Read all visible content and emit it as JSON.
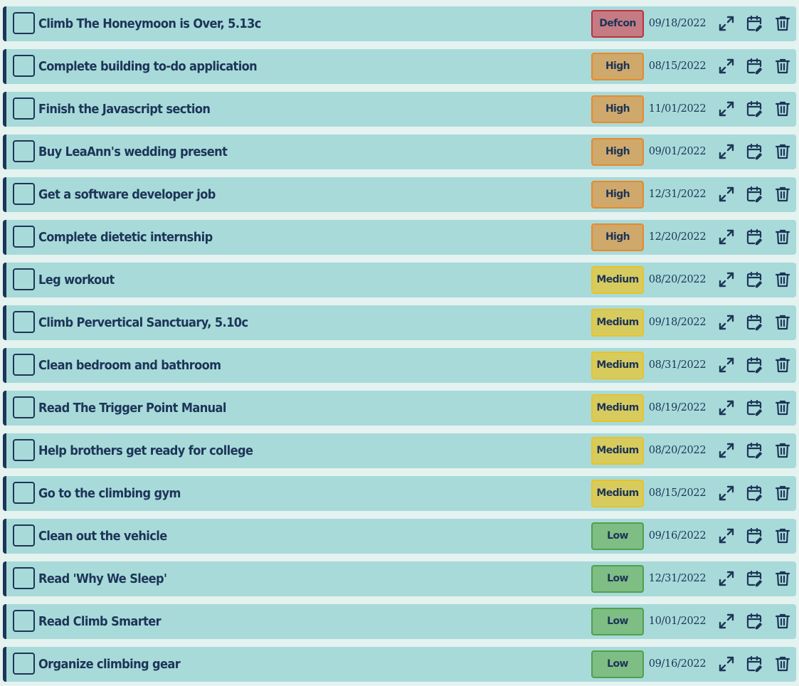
{
  "colors": {
    "background": "#e4f2f0",
    "row": "#a8dada",
    "text": "#1d3557",
    "priority": {
      "Defcon": {
        "bg": "#c47b84",
        "border": "#c0303d"
      },
      "High": {
        "bg": "#cfa86b",
        "border": "#e8892b"
      },
      "Medium": {
        "bg": "#d8cb5e",
        "border": "#e7c325"
      },
      "Low": {
        "bg": "#7ebd84",
        "border": "#4fa04b"
      }
    }
  },
  "icons": {
    "expand": "expand-diagonal-icon",
    "reschedule": "calendar-edit-icon",
    "delete": "trash-icon"
  },
  "todos": [
    {
      "title": "Climb The Honeymoon is Over, 5.13c",
      "priority": "Defcon",
      "date": "09/18/2022"
    },
    {
      "title": "Complete building to-do application",
      "priority": "High",
      "date": "08/15/2022"
    },
    {
      "title": "Finish the Javascript section",
      "priority": "High",
      "date": "11/01/2022"
    },
    {
      "title": "Buy LeaAnn's wedding present",
      "priority": "High",
      "date": "09/01/2022"
    },
    {
      "title": "Get a software developer job",
      "priority": "High",
      "date": "12/31/2022"
    },
    {
      "title": "Complete dietetic internship",
      "priority": "High",
      "date": "12/20/2022"
    },
    {
      "title": "Leg workout",
      "priority": "Medium",
      "date": "08/20/2022"
    },
    {
      "title": "Climb Pervertical Sanctuary, 5.10c",
      "priority": "Medium",
      "date": "09/18/2022"
    },
    {
      "title": "Clean bedroom and bathroom",
      "priority": "Medium",
      "date": "08/31/2022"
    },
    {
      "title": "Read The Trigger Point Manual",
      "priority": "Medium",
      "date": "08/19/2022"
    },
    {
      "title": "Help brothers get ready for college",
      "priority": "Medium",
      "date": "08/20/2022"
    },
    {
      "title": "Go to the climbing gym",
      "priority": "Medium",
      "date": "08/15/2022"
    },
    {
      "title": "Clean out the vehicle",
      "priority": "Low",
      "date": "09/16/2022"
    },
    {
      "title": "Read 'Why We Sleep'",
      "priority": "Low",
      "date": "12/31/2022"
    },
    {
      "title": "Read Climb Smarter",
      "priority": "Low",
      "date": "10/01/2022"
    },
    {
      "title": "Organize climbing gear",
      "priority": "Low",
      "date": "09/16/2022"
    }
  ]
}
